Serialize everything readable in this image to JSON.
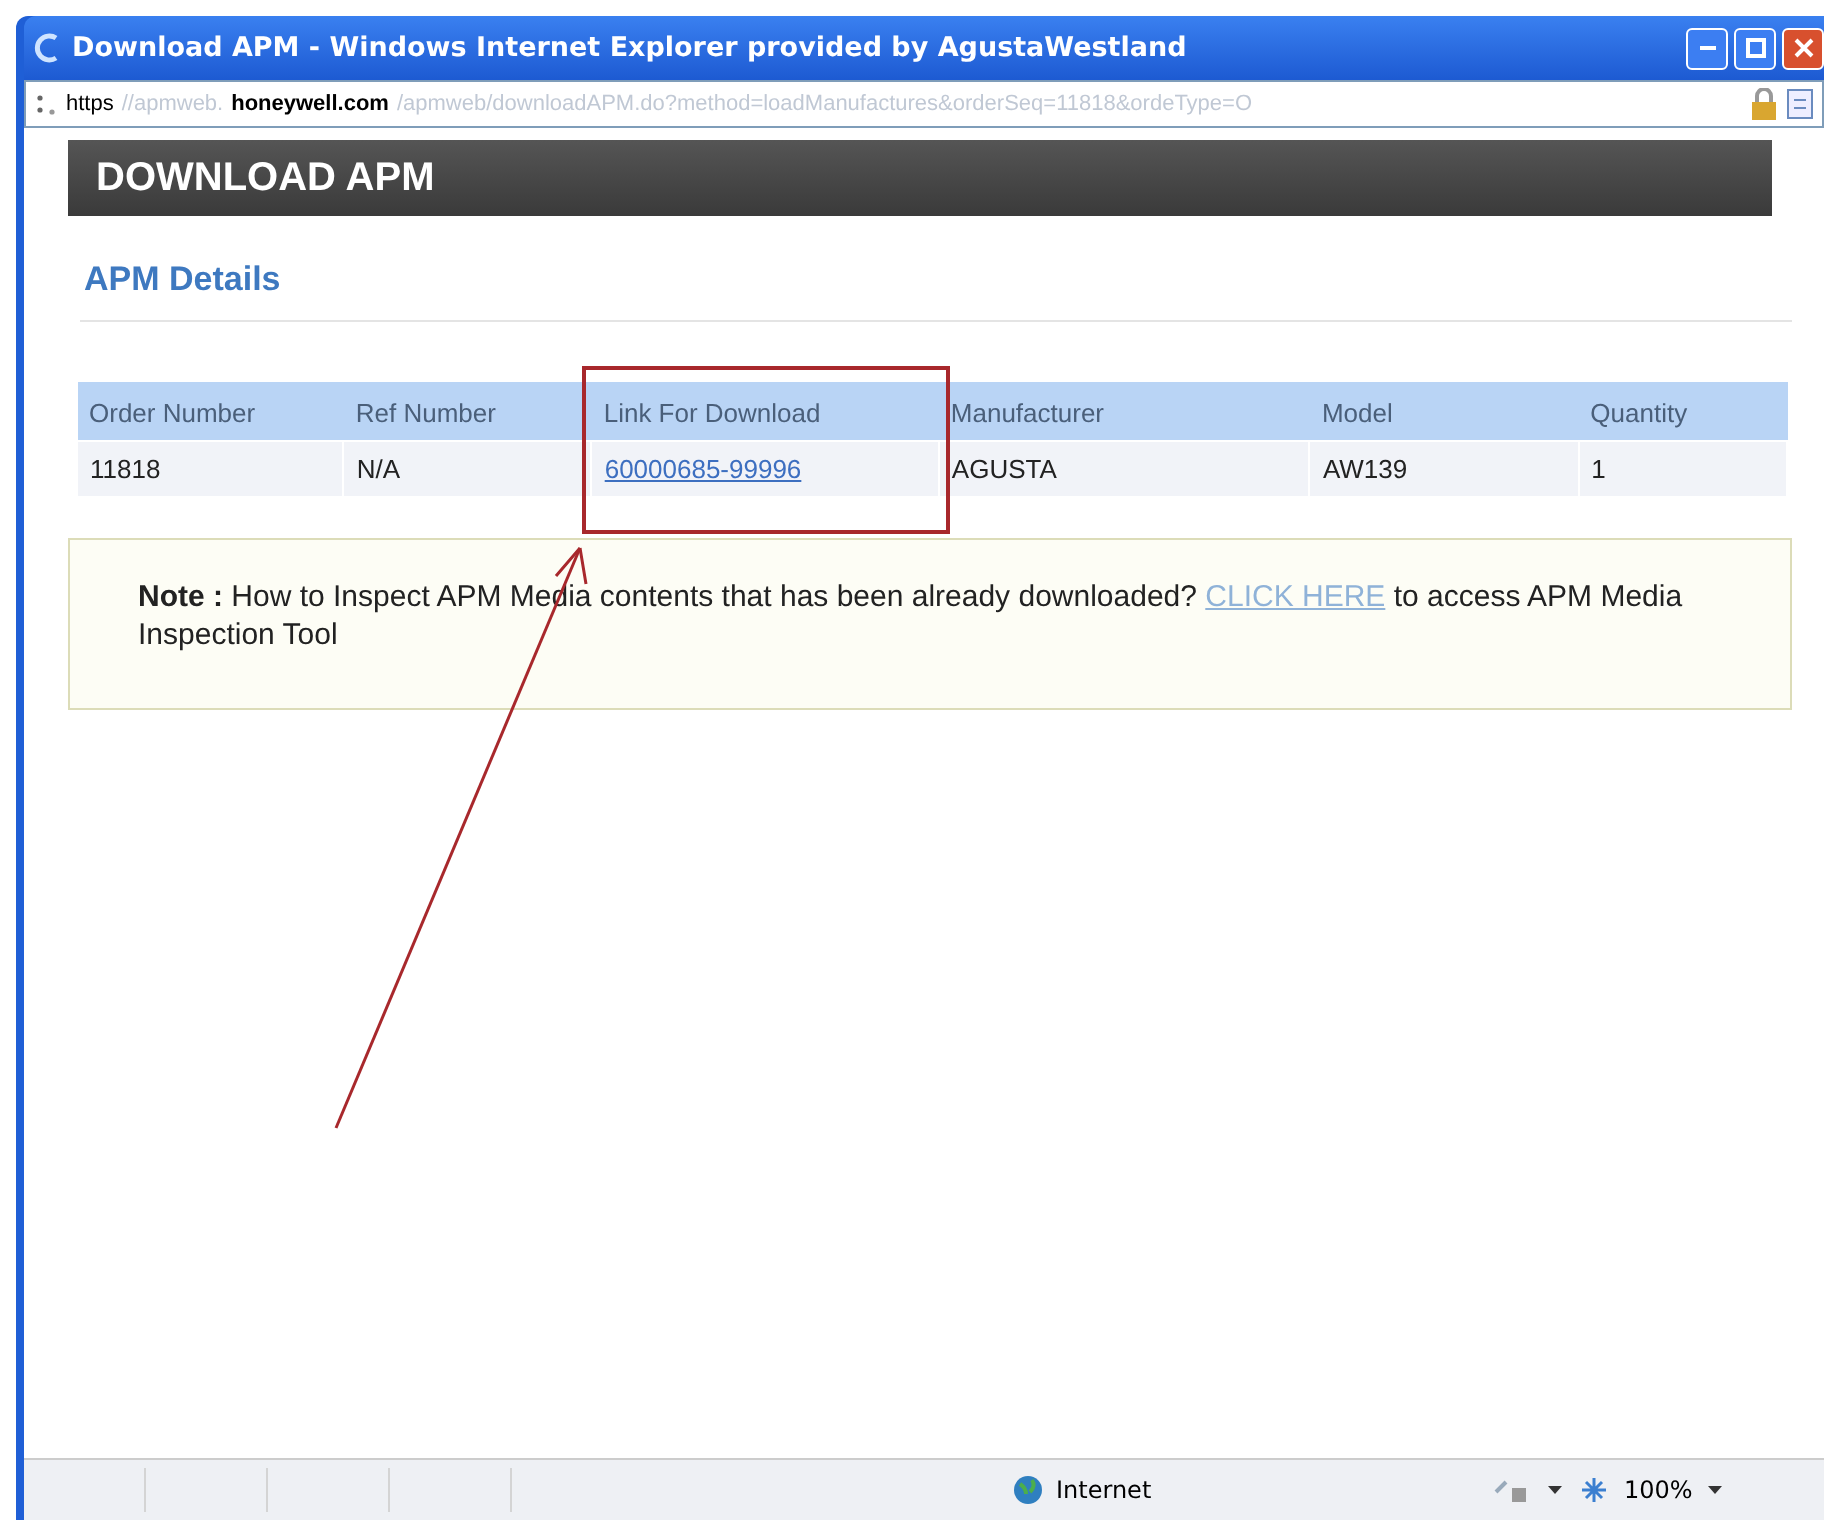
{
  "window": {
    "title": "Download APM - Windows Internet Explorer provided by AgustaWestland"
  },
  "address_bar": {
    "scheme": "https",
    "subdomain": "//apmweb.",
    "domain": "honeywell.com",
    "path": "/apmweb/downloadAPM.do?method=loadManufactures&orderSeq=11818&ordeType=O"
  },
  "page": {
    "header": "DOWNLOAD APM",
    "section_title": "APM Details",
    "table": {
      "columns": [
        {
          "label": "Order Number",
          "highlighted": false
        },
        {
          "label": "Ref Number",
          "highlighted": false
        },
        {
          "label": "Link For Download",
          "highlighted": true
        },
        {
          "label": "Manufacturer",
          "highlighted": false
        },
        {
          "label": "Model",
          "highlighted": false
        },
        {
          "label": "Quantity",
          "highlighted": false
        }
      ],
      "rows": [
        {
          "cells": [
            {
              "text": "11818",
              "kind": "text"
            },
            {
              "text": "N/A",
              "kind": "text"
            },
            {
              "text": "60000685-99996",
              "kind": "link"
            },
            {
              "text": "AGUSTA",
              "kind": "text"
            },
            {
              "text": "AW139",
              "kind": "text"
            },
            {
              "text": "1",
              "kind": "text"
            }
          ]
        }
      ]
    },
    "note": {
      "label": "Note :",
      "text_before": "How to Inspect APM Media contents that has been already downloaded?",
      "link": "CLICK HERE",
      "text_after": "to access APM Media Inspection Tool"
    }
  },
  "status_bar": {
    "zone": "Internet",
    "zoom": "100%"
  }
}
